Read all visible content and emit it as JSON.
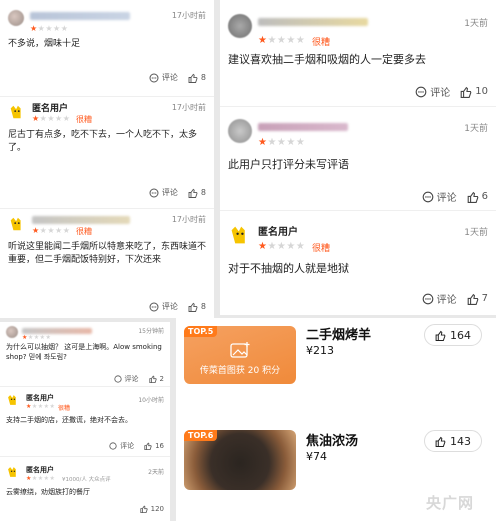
{
  "left_reviews": [
    {
      "time": "17小时前",
      "rating": 1,
      "rating_label": "",
      "text": "不多说，烟味十足",
      "comment_label": "评论",
      "likes": "8"
    },
    {
      "name": "匿名用户",
      "time": "17小时前",
      "rating": 1,
      "rating_label": "很糟",
      "text": "尼古丁有点多，吃不下去，一个人吃不下，太多了。",
      "comment_label": "评论",
      "likes": "8"
    },
    {
      "time": "17小时前",
      "rating": 1,
      "rating_label": "很糟",
      "text": "听说这里能闻二手烟所以特意来吃了，东西味道不重要，但二手烟配饭特别好，下次还来",
      "comment_label": "评论",
      "likes": "8"
    }
  ],
  "right_reviews": [
    {
      "time": "1天前",
      "rating": 1,
      "rating_label": "很糟",
      "text": "建议喜欢抽二手烟和吸烟的人一定要多去",
      "comment_label": "评论",
      "likes": "10"
    },
    {
      "time": "1天前",
      "rating": 1,
      "rating_label": "",
      "text": "此用户只打评分未写评语",
      "comment_label": "评论",
      "likes": "6"
    },
    {
      "name": "匿名用户",
      "time": "1天前",
      "rating": 1,
      "rating_label": "很糟",
      "text": "对于不抽烟的人就是地狱",
      "comment_label": "评论",
      "likes": "7"
    }
  ],
  "small_reviews": [
    {
      "time": "15分钟前",
      "text": "为什么可以抽烟？ 这可是上海啊。Alow smoking shop? 믿에 좌도림?",
      "comment_label": "评论",
      "likes": "2"
    },
    {
      "name": "匿名用户",
      "time": "10小时前",
      "rating_label": "很糟",
      "text": "支持二手烟的店，还撒谎，绝对不会去。",
      "comment_label": "评论",
      "likes": "16"
    },
    {
      "name": "匿名用户",
      "time": "2天前",
      "meta": "¥1000/人  大众点评",
      "text": "云雾缭绕，劝烟族打的餐厅",
      "likes": "120"
    }
  ],
  "dishes": [
    {
      "rank": "TOP.5",
      "name": "二手烟烤羊",
      "price": "¥213",
      "likes": "164",
      "placeholder_text": "传菜首图获 20 积分"
    },
    {
      "rank": "TOP.6",
      "name": "焦油浓汤",
      "price": "¥74",
      "likes": "143"
    }
  ],
  "watermark": "央广网",
  "colors": {
    "accent": "#ff5a1f",
    "badge": "#ff7a1a",
    "anon_avatar": "#f6c400"
  }
}
